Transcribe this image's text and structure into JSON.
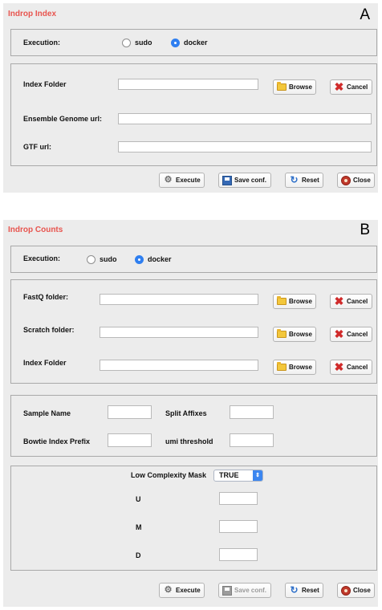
{
  "panelA": {
    "label": "A",
    "title": "Indrop Index",
    "execution": {
      "label": "Execution:",
      "options": [
        "sudo",
        "docker"
      ],
      "selected": "docker"
    },
    "fields": {
      "index_folder": {
        "label": "Index Folder",
        "value": ""
      },
      "ensemble_url": {
        "label": "Ensemble Genome url:",
        "value": ""
      },
      "gtf_url": {
        "label": "GTF url:",
        "value": ""
      }
    },
    "buttons": {
      "browse": "Browse",
      "cancel": "Cancel",
      "execute": "Execute",
      "save": "Save conf.",
      "reset": "Reset",
      "close": "Close"
    }
  },
  "panelB": {
    "label": "B",
    "title": "Indrop Counts",
    "execution": {
      "label": "Execution:",
      "options": [
        "sudo",
        "docker"
      ],
      "selected": "docker"
    },
    "folders": [
      {
        "label": "FastQ  folder:",
        "value": ""
      },
      {
        "label": "Scratch folder:",
        "value": ""
      },
      {
        "label": "Index Folder",
        "value": ""
      }
    ],
    "params": {
      "sample_name": "Sample Name",
      "split_affixes": "Split Affixes",
      "bowtie_prefix": "Bowtie Index Prefix",
      "umi_threshold": "umi threshold"
    },
    "mask": {
      "label": "Low Complexity Mask",
      "value": "TRUE"
    },
    "umd": [
      "U",
      "M",
      "D"
    ],
    "buttons": {
      "browse": "Browse",
      "cancel": "Cancel",
      "execute": "Execute",
      "save": "Save conf.",
      "reset": "Reset",
      "close": "Close"
    }
  },
  "icons": {
    "browse": "folder-icon",
    "cancel": "x-icon",
    "execute": "execute-icon",
    "save": "save-icon",
    "reset": "reset-icon",
    "close": "close-icon"
  },
  "colors": {
    "title": "#e8544e",
    "radio_selected": "#2f7ff0",
    "panel_bg": "#ececec"
  }
}
